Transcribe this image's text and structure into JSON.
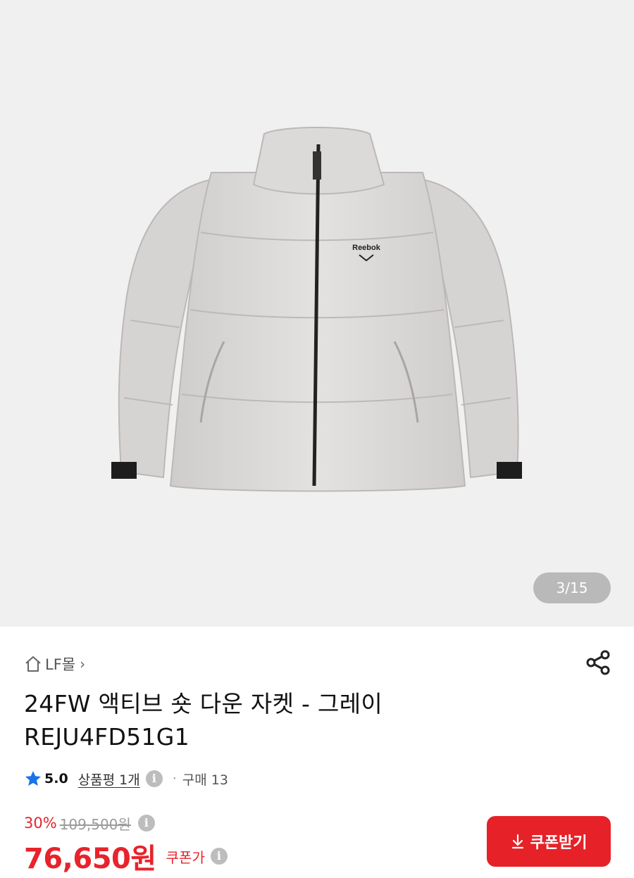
{
  "gallery": {
    "counter": "3/15",
    "brand_text": "Reebok"
  },
  "store": {
    "name": "LF몰",
    "chevron": "›"
  },
  "product": {
    "title_line1": "24FW 액티브 숏 다운 자켓 - 그레이",
    "title_line2": "REJU4FD51G1"
  },
  "rating": {
    "score": "5.0",
    "review_label": "상품평 1개",
    "separator": "·",
    "purchase_label": "구매 13"
  },
  "price": {
    "discount": "30%",
    "original": "109,500원",
    "final": "76,650원",
    "coupon_price_label": "쿠폰가"
  },
  "coupon_button": {
    "label": "쿠폰받기"
  },
  "info_glyph": "i",
  "colors": {
    "accent_red": "#e8232b",
    "button_red": "#e62128",
    "star_blue": "#1a73e8",
    "hero_bg": "#f1f0f0"
  },
  "icons": [
    "home-icon",
    "share-icon",
    "star-icon",
    "info-icon",
    "download-icon"
  ]
}
